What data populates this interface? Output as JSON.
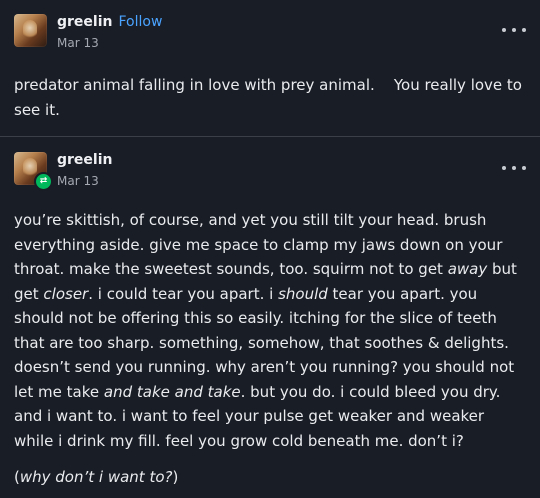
{
  "post": {
    "author": "greelin",
    "follow_label": "Follow",
    "date": "Mar 13",
    "text_a": "predator animal falling in love with prey animal.",
    "text_b": "You really love to see it."
  },
  "reblog": {
    "author": "greelin",
    "date": "Mar 13",
    "badge_icon": "reblog-icon",
    "badge_color": "#00b85c",
    "paragraph1": [
      "you’re skittish, of course, and yet you still tilt your head. brush everything aside. give me space to clamp my jaws down on your throat. make the sweetest sounds, too. squirm not to get ",
      "away",
      " but get ",
      "closer",
      ". i could tear you apart. i ",
      "should",
      " tear you apart. you should not be offering this so easily. itching for the slice of teeth that are too sharp. something, somehow, that soothes & delights.  doesn’t send you running. why aren’t you running? you should not let me take ",
      "and take and take",
      ".  but you do. i could bleed you dry. and i want to. i want to feel your pulse get weaker and weaker while i drink my fill. feel you grow cold beneath me. don’t i?"
    ],
    "paragraph2": [
      "(",
      "why don’t i want to?",
      ")"
    ]
  },
  "icons": {
    "more": "more-options-icon"
  },
  "colors": {
    "background": "#191d25",
    "follow": "#4aa3ff",
    "text": "#e9ebee",
    "meta": "#a4a9b2"
  }
}
